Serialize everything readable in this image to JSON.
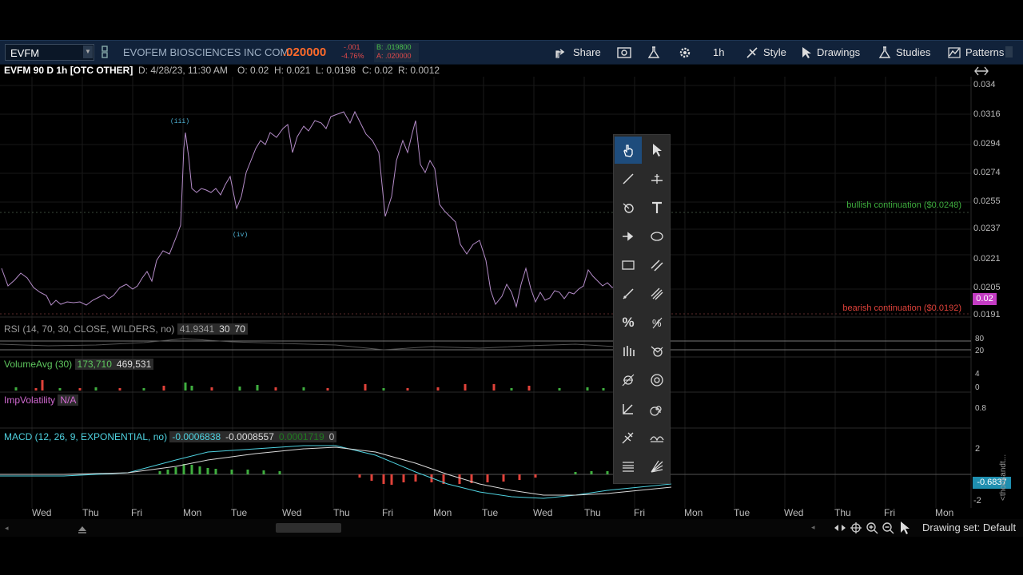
{
  "toolbar": {
    "symbol": "EVFM",
    "company": "EVOFEM BIOSCIENCES INC COM",
    "last_price": ".020000",
    "change": "-.001",
    "change_pct": "-4.76%",
    "bid": "B: .019800",
    "ask": "A: .020000",
    "share_label": "Share",
    "timeframe": "1h",
    "style_label": "Style",
    "drawings_label": "Drawings",
    "studies_label": "Studies",
    "patterns_label": "Patterns"
  },
  "infobar": {
    "title": "EVFM 90 D 1h [OTC OTHER]",
    "date": "D: 4/28/23, 11:30 AM",
    "open": "O: 0.02",
    "high": "H: 0.021",
    "low": "L: 0.0198",
    "close": "C: 0.02",
    "range": "R: 0.0012"
  },
  "price_axis": [
    "0.034",
    "0.0316",
    "0.0294",
    "0.0274",
    "0.0255",
    "0.0237",
    "0.0221",
    "0.0205",
    "0.0191"
  ],
  "current_price_tag": "0.02",
  "annotations": {
    "wave_iii": "(iii)",
    "wave_iv": "(iv)",
    "bullish": "bullish continuation ($0.0248)",
    "bearish": "bearish continuation ($0.0192)"
  },
  "studies": {
    "rsi": {
      "name": "RSI (14, 70, 30, CLOSE, WILDERS, no)",
      "value": "41.9341",
      "lower": "30",
      "upper": "70",
      "axis": [
        "80",
        "20"
      ]
    },
    "volume": {
      "name": "VolumeAvg (30)",
      "avg": "173,710",
      "vol": "469,531",
      "axis": [
        "4",
        "0"
      ]
    },
    "iv": {
      "name": "ImpVolatility",
      "value": "N/A",
      "axis": [
        "0.8"
      ]
    },
    "macd": {
      "name": "MACD (12, 26, 9, EXPONENTIAL, no)",
      "value": "-0.0006838",
      "avg": "-0.0008557",
      "diff": "0.0001719",
      "zero": "0",
      "axis": [
        "2",
        "-2"
      ],
      "tag": "-0.6837",
      "side_label": "<thousandt..."
    }
  },
  "time_axis": [
    "Wed",
    "Thu",
    "Fri",
    "Mon",
    "Tue",
    "Wed",
    "Thu",
    "Fri",
    "Mon",
    "Tue",
    "Wed",
    "Thu",
    "Fri",
    "Mon",
    "Tue",
    "Wed",
    "Thu",
    "Fri",
    "Mon"
  ],
  "bottom": {
    "drawing_set": "Drawing set: Default"
  },
  "colors": {
    "price_line": "#b48cc8",
    "bullish": "#3fae3f",
    "bearish": "#e0423a",
    "macd_line": "#4fd2e0",
    "macd_avg": "#d9d9d9",
    "price_tag": "#c43cc4",
    "accent": "#1e4c7c"
  },
  "palette_icons": [
    "hand-icon",
    "cursor-icon",
    "trendline-icon",
    "price-level-icon",
    "circle-dot-icon",
    "text-icon",
    "arrow-icon",
    "ellipse-icon",
    "rectangle-icon",
    "parallel-channel-icon",
    "ray-icon",
    "regression-channel-icon",
    "percent-icon",
    "percent-alt-icon",
    "volume-profile-icon",
    "gann-fan-icon",
    "fib-extension-icon",
    "fib-circle-icon",
    "angle-icon",
    "spiral-icon",
    "pitchfork-icon",
    "cycles-icon",
    "fib-retracement-icon",
    "speed-fan-icon"
  ]
}
